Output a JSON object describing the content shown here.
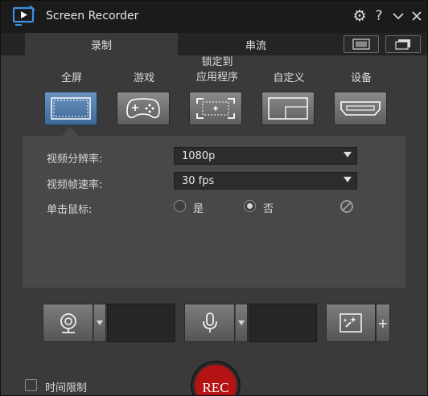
{
  "window": {
    "title": "Screen Recorder"
  },
  "titlebar_controls": {
    "help_glyph": "?"
  },
  "tabs": [
    {
      "label": "录制",
      "active": true
    },
    {
      "label": "串流",
      "active": false
    }
  ],
  "capture_modes": [
    {
      "label": "全屏",
      "icon": "fullscreen-icon",
      "active": true
    },
    {
      "label": "游戏",
      "icon": "gamepad-icon",
      "active": false
    },
    {
      "label": "锁定到\n应用程序",
      "icon": "lock-to-app-icon",
      "active": false
    },
    {
      "label": "自定义",
      "icon": "custom-region-icon",
      "active": false
    },
    {
      "label": "设备",
      "icon": "hdmi-device-icon",
      "active": false
    }
  ],
  "settings": {
    "resolution": {
      "label": "视频分辨率:",
      "value": "1080p"
    },
    "frame_rate": {
      "label": "视频帧速率:",
      "value": "30 fps"
    },
    "mouse_click": {
      "label": "单击鼠标:",
      "options": [
        {
          "label": "是",
          "checked": false
        },
        {
          "label": "否",
          "checked": true
        }
      ]
    }
  },
  "devices": {
    "webcam_icon": "webcam-icon",
    "mic_icon": "microphone-icon",
    "effects_icon": "effects-icon",
    "add_glyph": "+"
  },
  "time_limit": {
    "label": "时间限制",
    "checked": false
  },
  "rec_button": {
    "label": "REC"
  },
  "colors": {
    "accent": "#4f7dab",
    "rec": "#b41313",
    "background": "#3a3a3a",
    "titlebar": "#1b1b1b"
  }
}
